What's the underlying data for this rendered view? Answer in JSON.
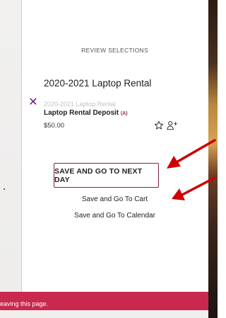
{
  "review": {
    "heading": "REVIEW SELECTIONS"
  },
  "item": {
    "title": "2020-2021 Laptop Rental",
    "subtitle": "2020-2021 Laptop Rental",
    "name": "Laptop Rental Deposit",
    "flag": "(A)",
    "price": "$50.00"
  },
  "actions": {
    "next_day": "SAVE AND GO TO NEXT DAY",
    "cart": "Save and Go To Cart",
    "calendar": "Save and Go To Calendar"
  },
  "banner": {
    "text": "eaving this page."
  },
  "colors": {
    "accent": "#8a2238",
    "banner": "#c8294d",
    "remove": "#6a1a7a",
    "annotation": "#cc0000"
  },
  "icons": {
    "remove": "close-icon",
    "favorite": "star-icon",
    "share": "add-person-icon"
  }
}
